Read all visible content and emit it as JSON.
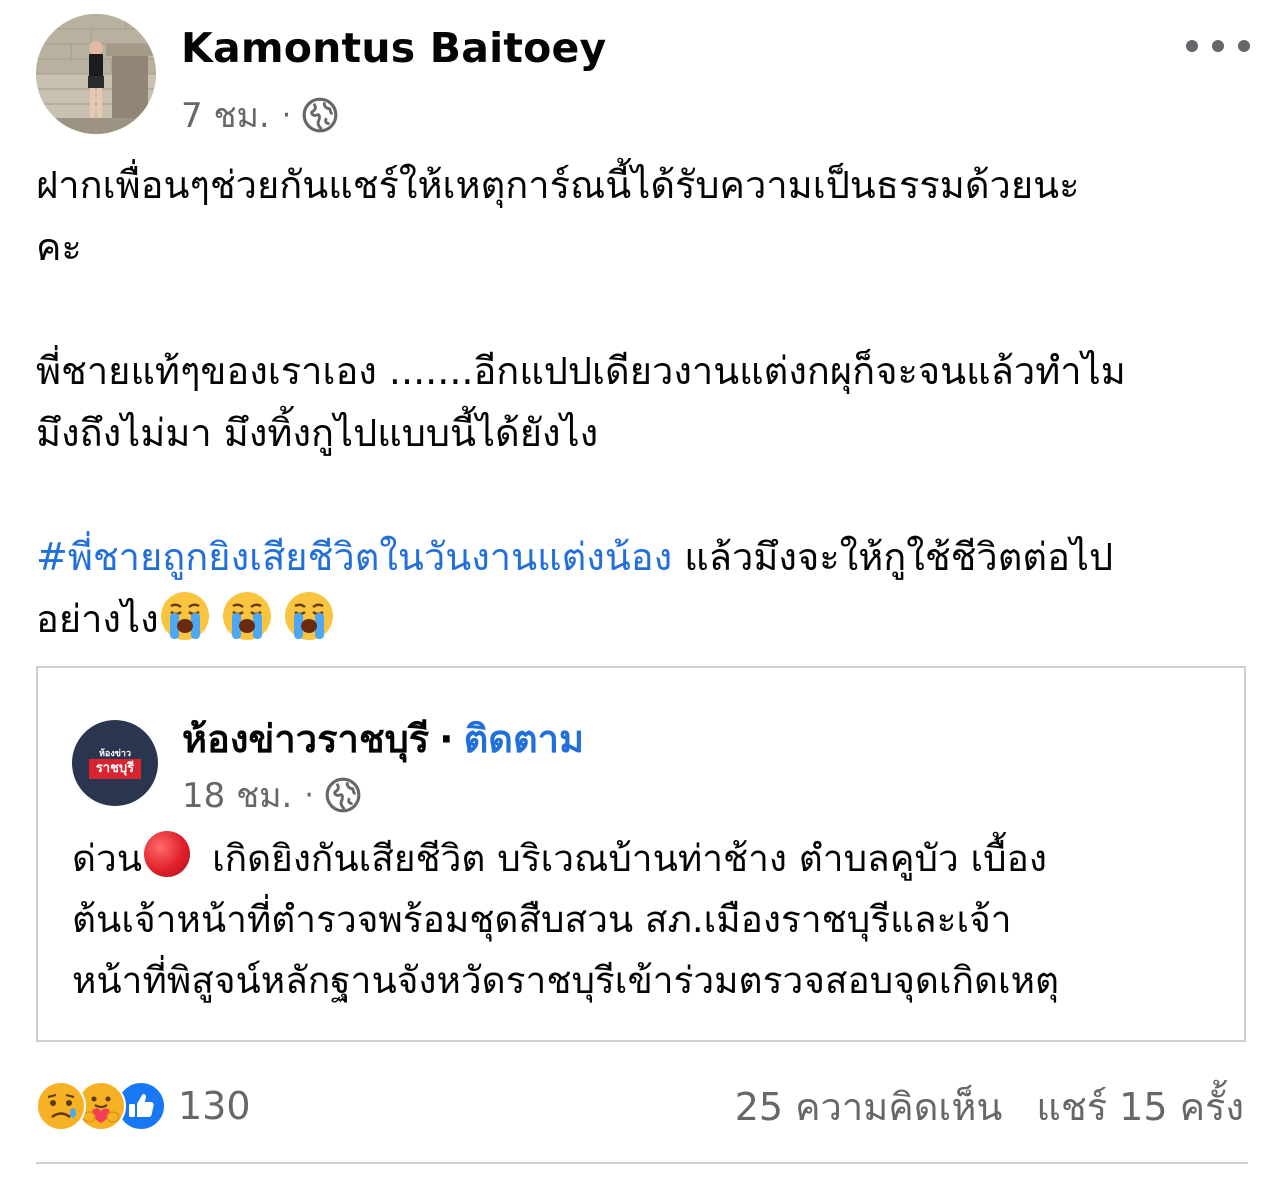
{
  "author": {
    "name": "Kamontus Baitoey",
    "time": "7 ชม.",
    "separator": "·",
    "privacy_icon": "globe-icon"
  },
  "more_icon": "more-horizontal-icon",
  "post": {
    "lines": [
      "ฝากเพื่อนๆช่วยกันแชร์ให้เหตุการ์ณนี้ได้รับความเป็นธรรมด้วยนะ",
      "คะ",
      "พี่ชายแท้ๆของเราเอง .......อีกแปปเดียวงานแต่งกผุก็จะจนแล้วทำไม",
      "มึงถึงไม่มา มึงทิ้งกูไปแบบนี้ได้ยังไง"
    ],
    "hashtag": "#พี่ชายถูกยิงเสียชีวิตในวันงานแต่งน้อง",
    "after_hashtag": " แล้วมึงจะให้กูใช้ชีวิตต่อไป",
    "last_line": "อย่างไง",
    "emoji": [
      "crying-face-emoji",
      "crying-face-emoji",
      "crying-face-emoji"
    ]
  },
  "shared": {
    "page_name": "ห้องข่าวราชบุรี",
    "separator": "·",
    "follow_label": "ติดตาม",
    "time": "18 ชม.",
    "avatar_top_text": "ห้องข่าว",
    "avatar_box_text": "ราชบุรี",
    "privacy_icon": "globe-icon",
    "first_word": "ด่วน",
    "lines": [
      "เกิดยิงกันเสียชีวิต บริเวณบ้านท่าช้าง ตำบลคูบัว เบื้อง",
      "ต้นเจ้าหน้าที่ตำรวจพร้อมชุดสืบสวน สภ.เมืองราชบุรีและเจ้า",
      "หน้าที่พิสูจน์หลักฐานจังหวัดราชบุรีเข้าร่วมตรวจสอบจุดเกิดเหตุ"
    ]
  },
  "footer": {
    "reaction_count": "130",
    "reactions": [
      "sad-reaction",
      "care-reaction",
      "like-reaction"
    ],
    "comments": "25 ความคิดเห็น",
    "shares": "แชร์ 15 ครั้ง"
  },
  "colors": {
    "link": "#216fdb",
    "secondary_text": "#65676b",
    "border": "#ced0d4"
  }
}
